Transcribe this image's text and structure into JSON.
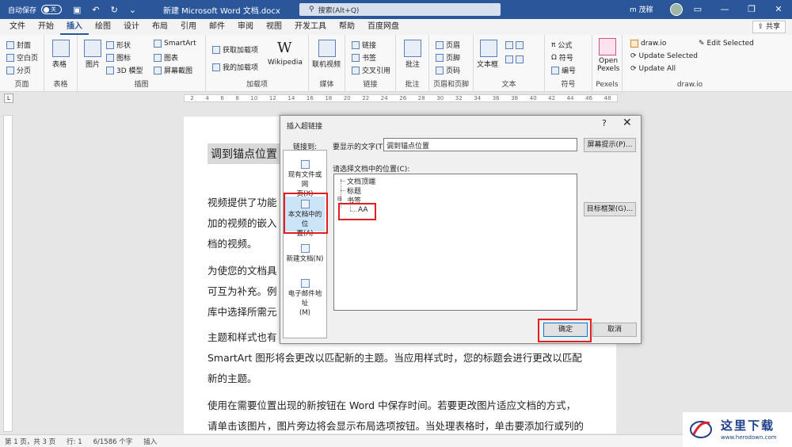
{
  "titlebar": {
    "autosave": "自动保存",
    "toggle": "关",
    "doc_title": "新建 Microsoft Word 文档.docx",
    "search_placeholder": "搜索(Alt+Q)",
    "user": "m 茂稼"
  },
  "menu": {
    "tabs": [
      "文件",
      "开始",
      "插入",
      "绘图",
      "设计",
      "布局",
      "引用",
      "邮件",
      "审阅",
      "视图",
      "开发工具",
      "帮助",
      "百度网盘"
    ],
    "active": "插入",
    "share": "共享"
  },
  "ribbon": {
    "pages": {
      "cover": "封面",
      "blank": "空白页",
      "break": "分页",
      "label": "页面"
    },
    "tables": {
      "table": "表格",
      "label": "表格"
    },
    "illustrations": {
      "picture": "图片",
      "shapes": "形状",
      "icons": "图标",
      "model3d": "3D 模型",
      "smartart": "SmartArt",
      "chart": "图表",
      "screenshot": "屏幕截图",
      "label": "插图"
    },
    "addins": {
      "get": "获取加载项",
      "mine": "我的加载项",
      "wikipedia": "Wikipedia",
      "label": "加载项"
    },
    "media": {
      "online_video": "联机视频",
      "label": "媒体"
    },
    "links": {
      "link": "链接",
      "bookmark": "书签",
      "crossref": "交叉引用",
      "label": "链接"
    },
    "comments": {
      "comment": "批注",
      "label": "批注"
    },
    "header_footer": {
      "header": "页眉",
      "footer": "页脚",
      "page_number": "页码",
      "label": "页眉和页脚"
    },
    "text": {
      "textbox": "文本框",
      "label": "文本"
    },
    "symbols": {
      "equation": "公式",
      "symbol": "符号",
      "number": "编号",
      "label": "符号"
    },
    "pexels": {
      "open": "Open",
      "name": "Pexels",
      "label": "Pexels"
    },
    "drawio": {
      "site": "draw.io",
      "update_selected": "Update Selected",
      "update_all": "Update All",
      "edit_selected": "Edit Selected",
      "label": "draw.io"
    }
  },
  "document": {
    "heading": "调到锚点位置",
    "p1": [
      "视频提供了功能",
      "加的视频的嵌入",
      "档的视频。"
    ],
    "p2": [
      "为使您的文档具",
      "可互为补充。例",
      "库中选择所需元"
    ],
    "p3": [
      "主题和样式也有",
      "SmartArt 图形将会更改以匹配新的主题。当应用样式时，您的标题会进行更改以匹配",
      "新的主题。"
    ],
    "p4": [
      "使用在需要位置出现的新按钮在 Word 中保存时间。若要更改图片适应文档的方式，",
      "请单击该图片，图片旁边将会显示布局选项按钮。当处理表格时，单击要添加行或列的"
    ]
  },
  "dialog": {
    "title": "插入超链接",
    "help": "?",
    "close": "✕",
    "link_to": "链接到:",
    "options": [
      {
        "label": "现有文件或网页(X)",
        "lines": [
          "现有文件或网",
          "页(X)"
        ]
      },
      {
        "label": "本文档中的位置(A)",
        "lines": [
          "本文档中的位",
          "置(A)"
        ]
      },
      {
        "label": "新建文档(N)",
        "lines": [
          "新建文档(N)"
        ]
      },
      {
        "label": "电子邮件地址(M)",
        "lines": [
          "电子邮件地址",
          "(M)"
        ]
      }
    ],
    "display_text_label": "要显示的文字(T):",
    "display_text_value": "调到锚点位置",
    "screentip": "屏幕提示(P)...",
    "select_place": "请选择文档中的位置(C):",
    "tree": {
      "top": "文档顶端",
      "headings": "标题",
      "bookmarks": "书签",
      "bookmark_item": "AA"
    },
    "target_frame": "目标框架(G)...",
    "ok": "确定",
    "cancel": "取消"
  },
  "statusbar": {
    "page": "第 1 页，共 3 页",
    "line": "行: 1",
    "words": "6/1586 个字",
    "mode": "插入"
  },
  "watermark": {
    "text": "这里下载",
    "url": "www.herodown.com"
  }
}
